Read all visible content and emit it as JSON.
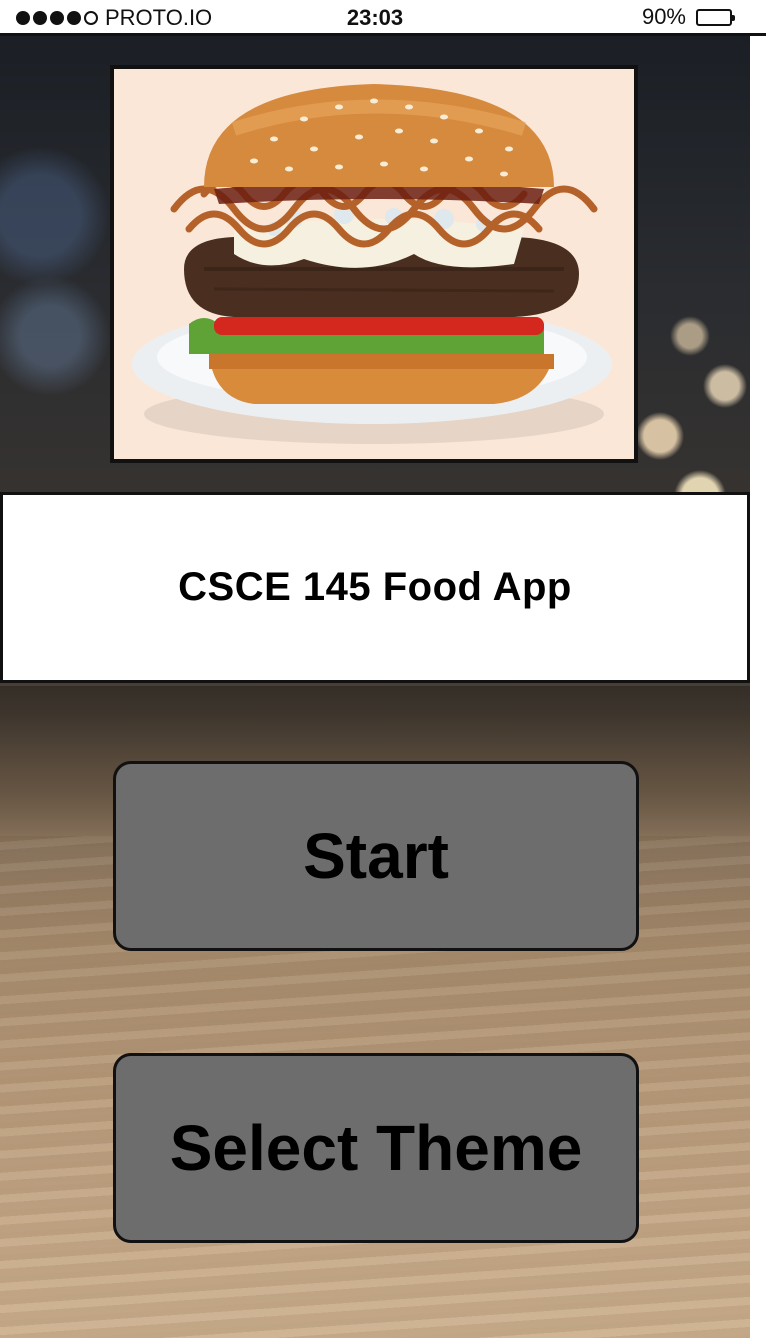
{
  "status_bar": {
    "carrier": "PROTO.IO",
    "time": "23:03",
    "battery": "90%",
    "battery_level": 0.9
  },
  "hero": {
    "icon": "burger-image"
  },
  "app": {
    "title": "CSCE 145 Food App"
  },
  "buttons": {
    "start_label": "Start",
    "select_theme_label": "Select Theme"
  },
  "colors": {
    "button_bg": "#6d6d6d",
    "border": "#111111"
  }
}
